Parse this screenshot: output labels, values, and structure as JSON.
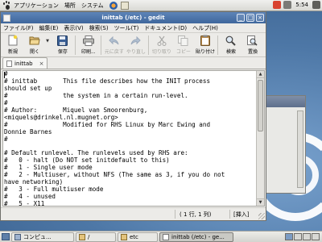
{
  "top_panel": {
    "menus": [
      "アプリケーション",
      "場所",
      "システム"
    ],
    "clock": "5:54"
  },
  "window": {
    "title": "inittab (/etc) - gedit",
    "controls": {
      "minimize": "_",
      "maximize": "□",
      "close": "×"
    }
  },
  "menubar": [
    "ファイル(F)",
    "編集(E)",
    "表示(V)",
    "検索(S)",
    "ツール(T)",
    "ドキュメント(D)",
    "ヘルプ(H)"
  ],
  "toolbar": {
    "new": "新規",
    "open": "開く",
    "save": "保存",
    "print": "印刷...",
    "undo": "元に戻す",
    "redo": "やり直し",
    "cut": "切り取り",
    "copy": "コピー",
    "paste": "貼り付け",
    "find": "検索",
    "replace": "置換"
  },
  "tab": {
    "label": "inittab",
    "close": "×"
  },
  "editor": {
    "lines": [
      "#",
      "# inittab       This file describes how the INIT process",
      "should set up",
      "#               the system in a certain run-level.",
      "#",
      "# Author:       Miquel van Smoorenburg,",
      "<miquels@drinkel.nl.mugnet.org>",
      "#               Modified for RHS Linux by Marc Ewing and",
      "Donnie Barnes",
      "#",
      "",
      "# Default runlevel. The runlevels used by RHS are:",
      "#   0 - halt (Do NOT set initdefault to this)",
      "#   1 - Single user mode",
      "#   2 - Multiuser, without NFS (The same as 3, if you do not",
      "have networking)",
      "#   3 - Full multiuser mode",
      "#   4 - unused",
      "#   5 - X11"
    ]
  },
  "statusbar": {
    "position": "( 1 行,  1 列)",
    "mode": "[挿入]"
  },
  "taskbar": [
    {
      "label": "コンピュ...",
      "active": false
    },
    {
      "label": "/",
      "active": false
    },
    {
      "label": "etc",
      "active": false
    },
    {
      "label": "inittab (/etc) - ge...",
      "active": true
    }
  ],
  "colors": {
    "titlebar": "#4a72a8",
    "desktop": "#4d77a6"
  }
}
